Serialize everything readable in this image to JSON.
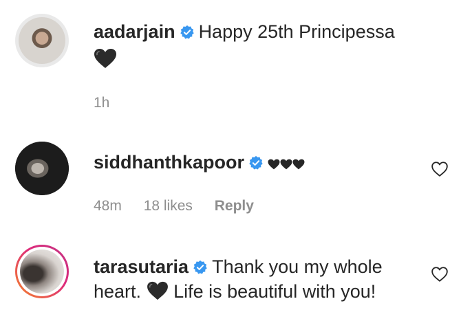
{
  "comments": [
    {
      "username": "aadarjain",
      "verified": true,
      "text": "Happy 25th Principessa",
      "heart": "black-heart-emoji",
      "meta": {
        "time": "1h"
      }
    },
    {
      "username": "siddhanthkapoor",
      "verified": true,
      "text": "",
      "hearts": [
        "black-heart",
        "black-heart",
        "black-heart"
      ],
      "meta": {
        "time": "48m",
        "likes": "18 likes",
        "reply": "Reply"
      }
    },
    {
      "username": "tarasutaria",
      "verified": true,
      "text_part1": "Thank you my whole heart.",
      "heart": "black-heart-emoji",
      "text_part2": "Life is beautiful with you!"
    }
  ],
  "colors": {
    "verified_blue": "#3897f0",
    "meta_gray": "#8e8e8e",
    "story_ring_start": "#f58529",
    "story_ring_end": "#dd2a7b"
  },
  "icons": [
    "verified-badge-icon",
    "heart-outline-icon",
    "black-heart-emoji"
  ]
}
